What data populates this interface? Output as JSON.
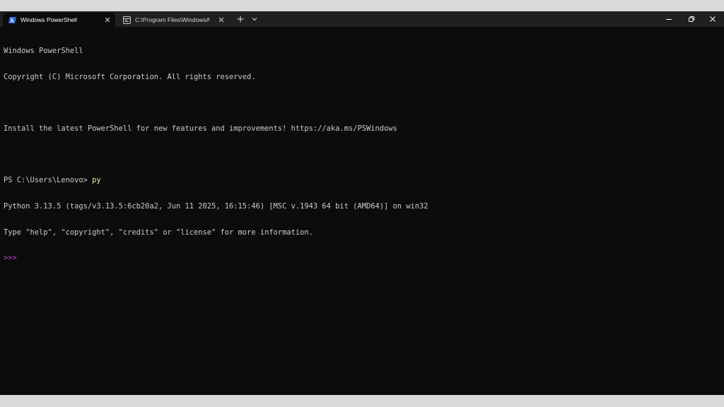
{
  "tabs": [
    {
      "label": "Windows PowerShell",
      "icon": "powershell-icon",
      "active": true
    },
    {
      "label": "C:\\Program Files\\WindowsApp",
      "icon": "terminal-app-icon",
      "active": false
    }
  ],
  "window_controls": {
    "minimize": "minimize-icon",
    "maximize": "restore-icon",
    "close": "close-icon"
  },
  "terminal": {
    "lines": [
      "Windows PowerShell",
      "Copyright (C) Microsoft Corporation. All rights reserved.",
      "",
      "Install the latest PowerShell for new features and improvements! https://aka.ms/PSWindows",
      "",
      "",
      "Python 3.13.5 (tags/v3.13.5:6cb20a2, Jun 11 2025, 16:15:46) [MSC v.1943 64 bit (AMD64)] on win32",
      "Type \"help\", \"copyright\", \"credits\" or \"license\" for more information."
    ],
    "ps_prompt": "PS C:\\Users\\Lenovo> ",
    "ps_command": "py",
    "python_prompt": ">>>"
  },
  "colors": {
    "background": "#0c0c0c",
    "titlebar": "#202020",
    "text": "#cccccc",
    "command": "#f9f1a5",
    "python_prompt": "#b148c6"
  }
}
